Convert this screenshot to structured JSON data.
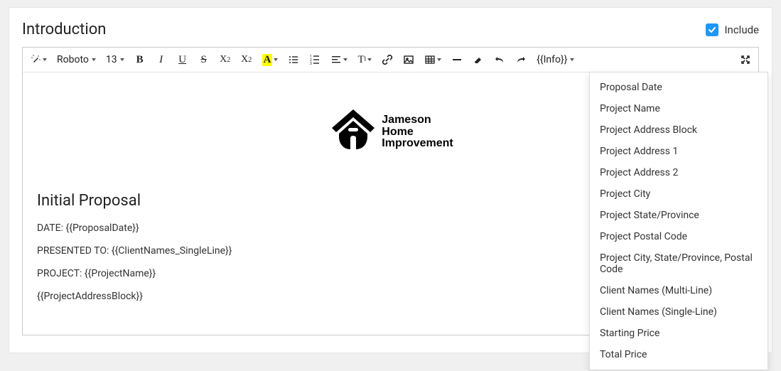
{
  "panel": {
    "title": "Introduction",
    "include_label": "Include",
    "include_checked": true
  },
  "toolbar": {
    "font_family": "Roboto",
    "font_size": "13",
    "info_label": "{{Info}}"
  },
  "logo": {
    "line1": "Jameson",
    "line2": "Home",
    "line3": "Improvement"
  },
  "content": {
    "heading": "Initial Proposal",
    "date_line": "DATE: {{ProposalDate}}",
    "presented_line": "PRESENTED TO: {{ClientNames_SingleLine}}",
    "project_line": "PROJECT: {{ProjectName}}",
    "address_line": "{{ProjectAddressBlock}}"
  },
  "dropdown": {
    "items": [
      "Proposal Date",
      "Project Name",
      "Project Address Block",
      "Project Address 1",
      "Project Address 2",
      "Project City",
      "Project State/Province",
      "Project Postal Code",
      "Project City, State/Province, Postal Code",
      "Client Names (Multi-Line)",
      "Client Names (Single-Line)",
      "Starting Price",
      "Total Price"
    ]
  }
}
